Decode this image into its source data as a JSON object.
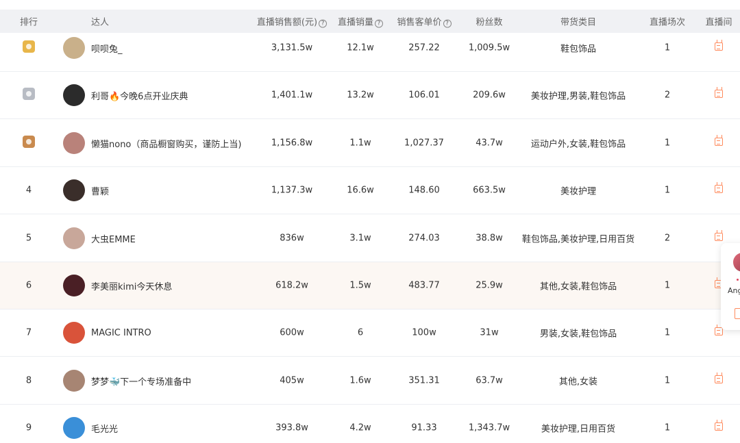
{
  "table": {
    "headers": {
      "rank": "排行",
      "streamer": "达人",
      "sales": "直播销售额(元)",
      "volume": "直播销量",
      "unit_price": "销售客单价",
      "fans": "粉丝数",
      "category": "带货类目",
      "sessions": "直播场次",
      "room": "直播间"
    },
    "rows": [
      {
        "rank": "1",
        "medal": "gold",
        "name": "呗呗兔_",
        "avatar_color": "#c9b08a",
        "sales": "3,131.5w",
        "volume": "12.1w",
        "price": "257.22",
        "fans": "1,009.5w",
        "category": "鞋包饰品",
        "sessions": "1"
      },
      {
        "rank": "2",
        "medal": "silver",
        "name": "利哥🔥今晚6点开业庆典",
        "avatar_color": "#2b2b2b",
        "sales": "1,401.1w",
        "volume": "13.2w",
        "price": "106.01",
        "fans": "209.6w",
        "category": "美妆护理,男装,鞋包饰品",
        "sessions": "2"
      },
      {
        "rank": "3",
        "medal": "bronze",
        "name": "懒猫nono（商品橱窗购买，谨防上当)",
        "avatar_color": "#b9827a",
        "sales": "1,156.8w",
        "volume": "1.1w",
        "price": "1,027.37",
        "fans": "43.7w",
        "category": "运动户外,女装,鞋包饰品",
        "sessions": "1"
      },
      {
        "rank": "4",
        "medal": "",
        "name": "曹颖",
        "avatar_color": "#3a2e2a",
        "sales": "1,137.3w",
        "volume": "16.6w",
        "price": "148.60",
        "fans": "663.5w",
        "category": "美妆护理",
        "sessions": "1"
      },
      {
        "rank": "5",
        "medal": "",
        "name": "大虫EMME",
        "avatar_color": "#c8a79a",
        "sales": "836w",
        "volume": "3.1w",
        "price": "274.03",
        "fans": "38.8w",
        "category": "鞋包饰品,美妆护理,日用百货",
        "sessions": "2"
      },
      {
        "rank": "6",
        "medal": "",
        "name": "李美丽kimi今天休息",
        "avatar_color": "#4a1f25",
        "sales": "618.2w",
        "volume": "1.5w",
        "price": "483.77",
        "fans": "25.9w",
        "category": "其他,女装,鞋包饰品",
        "sessions": "1"
      },
      {
        "rank": "7",
        "medal": "",
        "name": "MAGIC INTRO",
        "avatar_color": "#d9533a",
        "sales": "600w",
        "volume": "6",
        "price": "100w",
        "fans": "31w",
        "category": "男装,女装,鞋包饰品",
        "sessions": "1"
      },
      {
        "rank": "8",
        "medal": "",
        "name": "梦梦🐳下一个专场准备中",
        "avatar_color": "#a78573",
        "sales": "405w",
        "volume": "1.6w",
        "price": "351.31",
        "fans": "63.7w",
        "category": "其他,女装",
        "sessions": "1"
      },
      {
        "rank": "9",
        "medal": "",
        "name": "毛光光",
        "avatar_color": "#3a8fd8",
        "sales": "393.8w",
        "volume": "4.2w",
        "price": "91.33",
        "fans": "1,343.7w",
        "category": "美妆护理,日用百货",
        "sessions": "1"
      }
    ]
  },
  "side_card": {
    "label": "Ang"
  },
  "icons": {
    "help": "question-circle-icon",
    "live_room": "live-room-icon",
    "medal_gold": "#e8b64a",
    "medal_silver": "#b8bcc4",
    "medal_bronze": "#c98a4e",
    "accent": "#ff8a5c"
  }
}
